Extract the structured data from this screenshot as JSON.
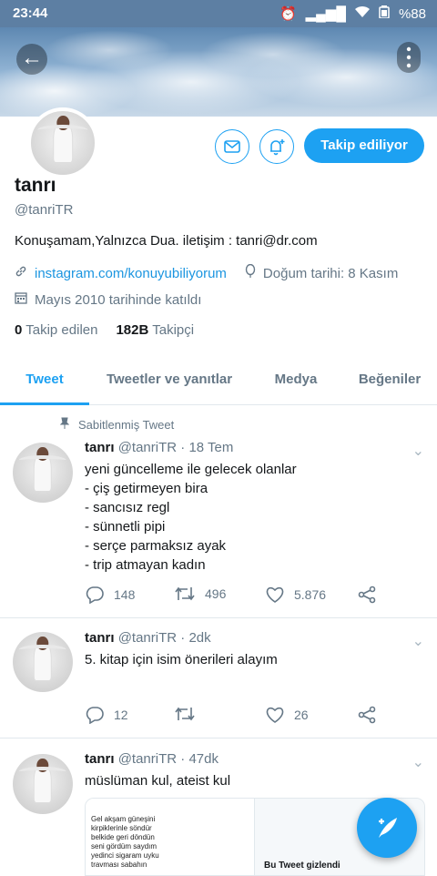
{
  "status": {
    "time": "23:44",
    "battery": "%88"
  },
  "profile": {
    "name": "tanrı",
    "handle": "@tanriTR",
    "bio": "Konuşamam,Yalnızca Dua. iletişim : tanri@dr.com",
    "link": "instagram.com/konuyubiliyorum",
    "birthday": "Doğum tarihi: 8 Kasım",
    "joined": "Mayıs 2010 tarihinde katıldı",
    "following_count": "0",
    "following_label": "Takip edilen",
    "followers_count": "182B",
    "followers_label": "Takipçi",
    "follow_button": "Takip ediliyor"
  },
  "tabs": [
    {
      "label": "Tweet"
    },
    {
      "label": "Tweetler ve yanıtlar"
    },
    {
      "label": "Medya"
    },
    {
      "label": "Beğeniler"
    }
  ],
  "pinned_label": "Sabitlenmiş Tweet",
  "tweets": [
    {
      "name": "tanrı",
      "handle": "@tanriTR",
      "time": "18 Tem",
      "text": "yeni güncelleme ile gelecek olanlar\n- çiş getirmeyen bira\n- sancısız regl\n- sünnetli pipi\n- serçe parmaksız ayak\n- trip atmayan kadın",
      "replies": "148",
      "retweets": "496",
      "likes": "5.876"
    },
    {
      "name": "tanrı",
      "handle": "@tanriTR",
      "time": "2dk",
      "text": "5. kitap için isim önerileri alayım",
      "replies": "12",
      "retweets": "",
      "likes": "26"
    },
    {
      "name": "tanrı",
      "handle": "@tanriTR",
      "time": "47dk",
      "text": "müslüman kul, ateist kul",
      "media_text": "Gel akşam güneşini\nkirpiklerinle söndür\nbelkide geri döndün\nseni gördüm saydım\nyedinci sigaram uyku\ntravması sabahın",
      "media_hidden": "Bu Tweet gizlendi"
    }
  ],
  "icons": {
    "back": "arrow-left-icon",
    "more": "more-vertical-icon",
    "message": "mail-icon",
    "notify": "bell-plus-icon",
    "compose": "compose-feather-icon"
  },
  "colors": {
    "accent": "#1da1f2",
    "muted": "#657786",
    "like": "#e0245e"
  }
}
